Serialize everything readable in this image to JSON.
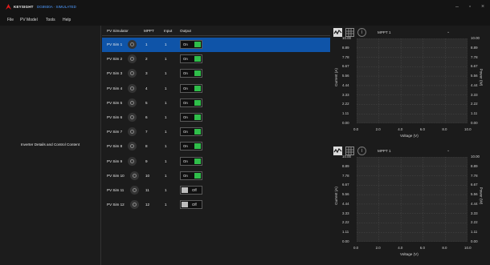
{
  "app": {
    "brand": "KEYSIGHT",
    "subtitle": "DG8930A · SIMULATED",
    "colors": {
      "accent": "#0f54a8",
      "on": "#2fbe4a",
      "brand_red": "#e21b1b"
    },
    "window_controls": [
      "minimize",
      "maximize",
      "close"
    ]
  },
  "menu": [
    "File",
    "PV Model",
    "Tools",
    "Help"
  ],
  "left": {
    "text": "Inverter Details and Control Content"
  },
  "table": {
    "headers": [
      "PV Simulator",
      "MPPT",
      "Input",
      "Output"
    ],
    "rows": [
      {
        "name": "PV Sim 1",
        "mppt": "1",
        "input": "1",
        "output": "On",
        "on": true,
        "selected": true
      },
      {
        "name": "PV Sim 2",
        "mppt": "2",
        "input": "1",
        "output": "On",
        "on": true
      },
      {
        "name": "PV Sim 3",
        "mppt": "3",
        "input": "1",
        "output": "On",
        "on": true
      },
      {
        "name": "PV Sim 4",
        "mppt": "4",
        "input": "1",
        "output": "On",
        "on": true
      },
      {
        "name": "PV Sim 5",
        "mppt": "5",
        "input": "1",
        "output": "On",
        "on": true
      },
      {
        "name": "PV Sim 6",
        "mppt": "6",
        "input": "1",
        "output": "On",
        "on": true
      },
      {
        "name": "PV Sim 7",
        "mppt": "7",
        "input": "1",
        "output": "On",
        "on": true
      },
      {
        "name": "PV Sim 8",
        "mppt": "8",
        "input": "1",
        "output": "On",
        "on": true
      },
      {
        "name": "PV Sim 9",
        "mppt": "9",
        "input": "1",
        "output": "On",
        "on": true
      },
      {
        "name": "PV Sim 10",
        "mppt": "10",
        "input": "1",
        "output": "On",
        "on": true
      },
      {
        "name": "PV Sim 11",
        "mppt": "11",
        "input": "1",
        "output": "Off",
        "on": false
      },
      {
        "name": "PV Sim 12",
        "mppt": "12",
        "input": "1",
        "output": "Off",
        "on": false
      }
    ]
  },
  "charts": [
    {
      "selector": "MPPT 1",
      "ylabel": "Current (A)",
      "y2label": "Power (W)",
      "xlabel": "Voltage (V)",
      "yticks": [
        "10.00",
        "8.89",
        "7.78",
        "6.67",
        "5.56",
        "4.44",
        "3.33",
        "2.22",
        "1.11",
        "0.00"
      ],
      "y2ticks": [
        "10.00",
        "8.89",
        "7.78",
        "6.67",
        "5.56",
        "4.44",
        "3.33",
        "2.22",
        "1.11",
        "0.00"
      ],
      "xticks": [
        "0.0",
        "2.0",
        "4.0",
        "6.0",
        "8.0",
        "10.0"
      ]
    },
    {
      "selector": "MPPT 1",
      "ylabel": "Current (A)",
      "y2label": "Power (W)",
      "xlabel": "Voltage (V)",
      "yticks": [
        "10.00",
        "8.89",
        "7.78",
        "6.67",
        "5.56",
        "4.44",
        "3.33",
        "2.22",
        "1.11",
        "0.00"
      ],
      "y2ticks": [
        "10.00",
        "8.89",
        "7.78",
        "6.67",
        "5.56",
        "4.44",
        "3.33",
        "2.22",
        "1.11",
        "0.00"
      ],
      "xticks": [
        "0.0",
        "2.0",
        "4.0",
        "6.0",
        "8.0",
        "10.0"
      ]
    }
  ]
}
